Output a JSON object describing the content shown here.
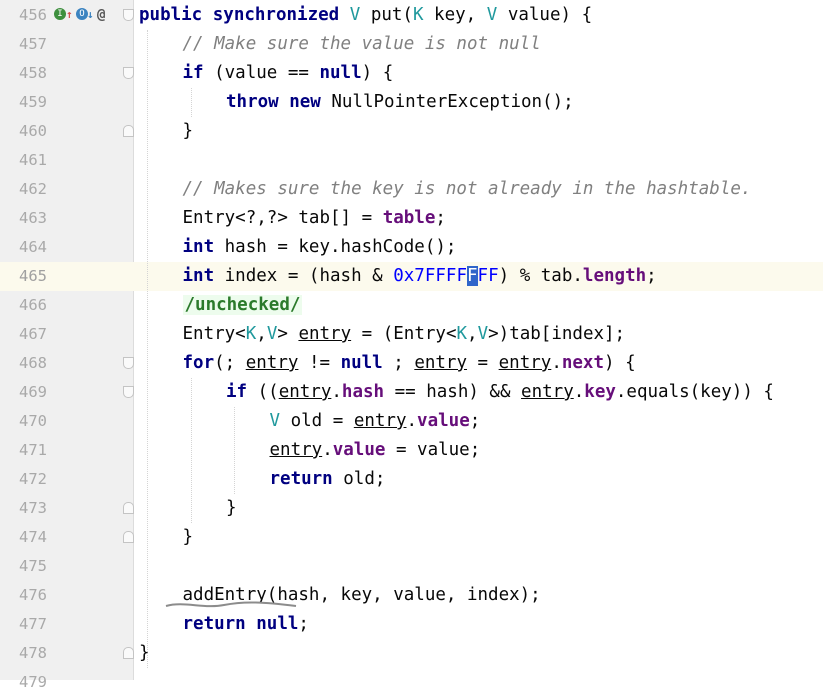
{
  "editor": {
    "current_line": "465",
    "lines": [
      {
        "num": "456",
        "segments": [
          {
            "t": "public synchronized",
            "c": "kw"
          },
          {
            "t": " "
          },
          {
            "t": "V",
            "c": "tp"
          },
          {
            "t": " put("
          },
          {
            "t": "K",
            "c": "tp"
          },
          {
            "t": " key, "
          },
          {
            "t": "V",
            "c": "tp"
          },
          {
            "t": " value) {"
          }
        ]
      },
      {
        "num": "457",
        "segments": [
          {
            "t": "// Make sure the value is not null",
            "c": "cm"
          }
        ]
      },
      {
        "num": "458",
        "segments": [
          {
            "t": "if",
            "c": "kw"
          },
          {
            "t": " (value == "
          },
          {
            "t": "null",
            "c": "kw"
          },
          {
            "t": ") {"
          }
        ]
      },
      {
        "num": "459",
        "segments": [
          {
            "t": "throw new",
            "c": "kw"
          },
          {
            "t": " NullPointerException();"
          }
        ]
      },
      {
        "num": "460",
        "segments": [
          {
            "t": "}"
          }
        ]
      },
      {
        "num": "461",
        "segments": []
      },
      {
        "num": "462",
        "segments": [
          {
            "t": "// Makes sure the key is not already in the hashtable.",
            "c": "cm"
          }
        ]
      },
      {
        "num": "463",
        "segments": [
          {
            "t": "Entry<?,?> tab[] = "
          },
          {
            "t": "table",
            "c": "fd"
          },
          {
            "t": ";"
          }
        ]
      },
      {
        "num": "464",
        "segments": [
          {
            "t": "int",
            "c": "kw"
          },
          {
            "t": " hash = key.hashCode();"
          }
        ]
      },
      {
        "num": "465",
        "segments": [
          {
            "t": "int",
            "c": "kw"
          },
          {
            "t": " index = (hash & "
          },
          {
            "t": "0x7FFFF",
            "c": "nm"
          },
          {
            "t": "F",
            "c": "caret"
          },
          {
            "t": "FF",
            "c": "nm"
          },
          {
            "t": ") % tab."
          },
          {
            "t": "length",
            "c": "fd"
          },
          {
            "t": ";"
          }
        ]
      },
      {
        "num": "466",
        "segments": [
          {
            "t": "/unchecked/",
            "c": "ann"
          }
        ]
      },
      {
        "num": "467",
        "segments": [
          {
            "t": "Entry<"
          },
          {
            "t": "K",
            "c": "tp"
          },
          {
            "t": ","
          },
          {
            "t": "V",
            "c": "tp"
          },
          {
            "t": "> "
          },
          {
            "t": "entry",
            "c": "ul"
          },
          {
            "t": " = (Entry<"
          },
          {
            "t": "K",
            "c": "tp"
          },
          {
            "t": ","
          },
          {
            "t": "V",
            "c": "tp"
          },
          {
            "t": ">)tab[index];"
          }
        ]
      },
      {
        "num": "468",
        "segments": [
          {
            "t": "for",
            "c": "kw"
          },
          {
            "t": "(; "
          },
          {
            "t": "entry",
            "c": "ul"
          },
          {
            "t": " != "
          },
          {
            "t": "null",
            "c": "kw"
          },
          {
            "t": " ; "
          },
          {
            "t": "entry",
            "c": "ul"
          },
          {
            "t": " = "
          },
          {
            "t": "entry",
            "c": "ul"
          },
          {
            "t": "."
          },
          {
            "t": "next",
            "c": "fd"
          },
          {
            "t": ") {"
          }
        ]
      },
      {
        "num": "469",
        "segments": [
          {
            "t": "if",
            "c": "kw"
          },
          {
            "t": " (("
          },
          {
            "t": "entry",
            "c": "ul"
          },
          {
            "t": "."
          },
          {
            "t": "hash",
            "c": "fd"
          },
          {
            "t": " == hash) && "
          },
          {
            "t": "entry",
            "c": "ul"
          },
          {
            "t": "."
          },
          {
            "t": "key",
            "c": "fd"
          },
          {
            "t": ".equals(key)) {"
          }
        ]
      },
      {
        "num": "470",
        "segments": [
          {
            "t": "V",
            "c": "tp"
          },
          {
            "t": " old = "
          },
          {
            "t": "entry",
            "c": "ul"
          },
          {
            "t": "."
          },
          {
            "t": "value",
            "c": "fd"
          },
          {
            "t": ";"
          }
        ]
      },
      {
        "num": "471",
        "segments": [
          {
            "t": "entry",
            "c": "ul"
          },
          {
            "t": "."
          },
          {
            "t": "value",
            "c": "fd"
          },
          {
            "t": " = value;"
          }
        ]
      },
      {
        "num": "472",
        "segments": [
          {
            "t": "return",
            "c": "kw"
          },
          {
            "t": " old;"
          }
        ]
      },
      {
        "num": "473",
        "segments": [
          {
            "t": "}"
          }
        ]
      },
      {
        "num": "474",
        "segments": [
          {
            "t": "}"
          }
        ]
      },
      {
        "num": "475",
        "segments": []
      },
      {
        "num": "476",
        "segments": [
          {
            "t": "addEntry(hash, key, value, index);"
          }
        ]
      },
      {
        "num": "477",
        "segments": [
          {
            "t": "return null",
            "c": "kw"
          },
          {
            "t": ";"
          }
        ]
      },
      {
        "num": "478",
        "segments": [
          {
            "t": "}"
          }
        ]
      },
      {
        "num": "479",
        "segments": []
      }
    ]
  },
  "gutter_icons": [
    "implementing-method-icon",
    "overrides-up-arrow-icon",
    "overridden-method-icon",
    "overridden-down-arrow-icon",
    "annotation-at-icon"
  ],
  "colors": {
    "keyword": "#000080",
    "type_param": "#20999d",
    "field": "#660e7a",
    "comment": "#808080",
    "number": "#0000ff",
    "caret_highlight": "#2f65ca",
    "current_line_bg": "#fcfaed",
    "gutter_bg": "#f0f0f0"
  }
}
